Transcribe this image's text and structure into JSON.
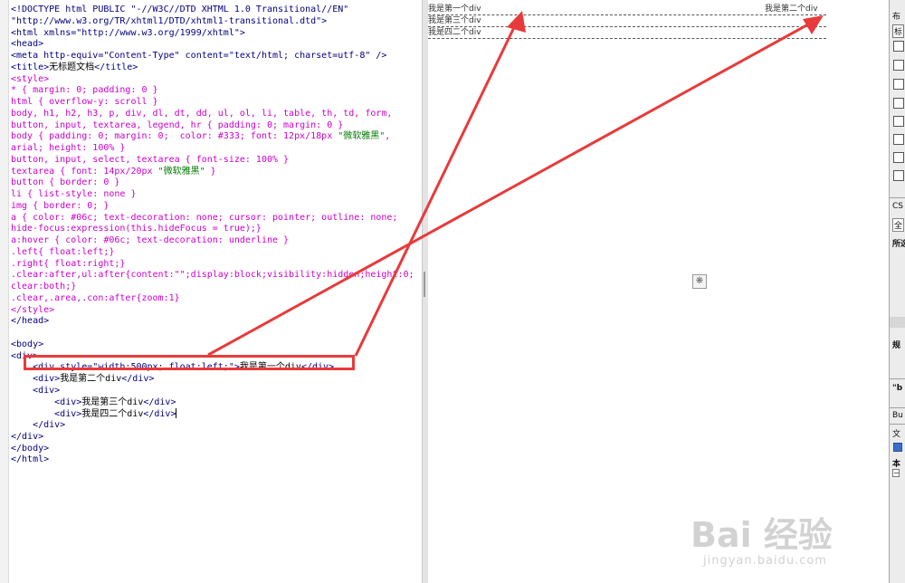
{
  "editor": {
    "lines": [
      [
        {
          "t": "<!DOCTYPE html PUBLIC \"-//W3C//DTD XHTML 1.0 Transitional//EN\"",
          "c": "c-tag"
        }
      ],
      [
        {
          "t": "\"http://www.w3.org/TR/xhtml1/DTD/xhtml1-transitional.dtd\">",
          "c": "c-tag"
        }
      ],
      [
        {
          "t": "<html xmlns=\"http://www.w3.org/1999/xhtml\">",
          "c": "c-tag"
        }
      ],
      [
        {
          "t": "<head>",
          "c": "c-tag"
        }
      ],
      [
        {
          "t": "<meta http-equiv=\"Content-Type\" content=\"text/html; charset=utf-8\" />",
          "c": "c-tag"
        }
      ],
      [
        {
          "t": "<title>",
          "c": "c-tag"
        },
        {
          "t": "无标题文档",
          "c": "c-txt"
        },
        {
          "t": "</title>",
          "c": "c-tag"
        }
      ],
      [
        {
          "t": "<style>",
          "c": "c-css"
        }
      ],
      [
        {
          "t": "* { margin: 0; padding: 0 }",
          "c": "c-css"
        }
      ],
      [
        {
          "t": "html { overflow-y: scroll }",
          "c": "c-css"
        }
      ],
      [
        {
          "t": "body, h1, h2, h3, p, div, dl, dt, dd, ul, ol, li, table, th, td, form,",
          "c": "c-css"
        }
      ],
      [
        {
          "t": "button, input, textarea, legend, hr { padding: 0; margin: 0 }",
          "c": "c-css"
        }
      ],
      [
        {
          "t": "body { padding: 0; margin: 0;  color: #333; font: 12px/18px ",
          "c": "c-css"
        },
        {
          "t": "\"微软雅黑\"",
          "c": "c-cn"
        },
        {
          "t": ",",
          "c": "c-css"
        }
      ],
      [
        {
          "t": "arial; height: 100% }",
          "c": "c-css"
        }
      ],
      [
        {
          "t": "button, input, select, textarea { font-size: 100% }",
          "c": "c-css"
        }
      ],
      [
        {
          "t": "textarea { font: 14px/20px ",
          "c": "c-css"
        },
        {
          "t": "\"微软雅黑\"",
          "c": "c-cn"
        },
        {
          "t": " }",
          "c": "c-css"
        }
      ],
      [
        {
          "t": "button { border: 0 }",
          "c": "c-css"
        }
      ],
      [
        {
          "t": "li { list-style: none }",
          "c": "c-css"
        }
      ],
      [
        {
          "t": "img { border: 0; }",
          "c": "c-css"
        }
      ],
      [
        {
          "t": "a { color: #06c; text-decoration: none; cursor: pointer; outline: none;",
          "c": "c-css"
        }
      ],
      [
        {
          "t": "hide-focus:expression(this.hideFocus = true);}",
          "c": "c-css"
        }
      ],
      [
        {
          "t": "a:hover { color: #06c; text-decoration: underline }",
          "c": "c-css"
        }
      ],
      [
        {
          "t": ".left{ float:left;}",
          "c": "c-css"
        }
      ],
      [
        {
          "t": ".right{ float:right;}",
          "c": "c-css"
        }
      ],
      [
        {
          "t": ".clear:after,ul:after{content:\"\";display:block;visibility:hidden;height:0;",
          "c": "c-css"
        }
      ],
      [
        {
          "t": "clear:both;}",
          "c": "c-css"
        }
      ],
      [
        {
          "t": ".clear,.area,.con:after{zoom:1}",
          "c": "c-css"
        }
      ],
      [
        {
          "t": "</style>",
          "c": "c-css"
        }
      ],
      [
        {
          "t": "</head>",
          "c": "c-tag"
        }
      ],
      [
        {
          "t": "",
          "c": "c-tag"
        }
      ],
      [
        {
          "t": "<body>",
          "c": "c-tag"
        }
      ],
      [
        {
          "t": "<div>",
          "c": "c-tag"
        }
      ],
      [
        {
          "t": "    <div style=\"width:500px; float:left;\">",
          "c": "c-tag"
        },
        {
          "t": "我是第一个div",
          "c": "c-txt"
        },
        {
          "t": "</div>",
          "c": "c-tag"
        }
      ],
      [
        {
          "t": "    <div>",
          "c": "c-tag"
        },
        {
          "t": "我是第二个div",
          "c": "c-txt"
        },
        {
          "t": "</div>",
          "c": "c-tag"
        }
      ],
      [
        {
          "t": "    <div>",
          "c": "c-tag"
        }
      ],
      [
        {
          "t": "        <div>",
          "c": "c-tag"
        },
        {
          "t": "我是第三个div",
          "c": "c-txt"
        },
        {
          "t": "</div>",
          "c": "c-tag"
        }
      ],
      [
        {
          "t": "        <div>",
          "c": "c-tag"
        },
        {
          "t": "我是四二个div",
          "c": "c-txt"
        },
        {
          "t": "</div>",
          "c": "c-tag"
        }
      ],
      [
        {
          "t": "    </div>",
          "c": "c-tag"
        }
      ],
      [
        {
          "t": "</div>",
          "c": "c-tag"
        }
      ],
      [
        {
          "t": "</body>",
          "c": "c-tag"
        }
      ],
      [
        {
          "t": "</html>",
          "c": "c-tag"
        }
      ]
    ],
    "caret_line": 35
  },
  "design": {
    "row1_left": "我是第一个div",
    "row1_right": "我是第二个div",
    "row2": "我是第三个div",
    "row3": "我是四二个div",
    "marker_glyph": "❋"
  },
  "panel": {
    "labels": [
      "布",
      "标",
      "CS",
      "全",
      "所选",
      "规",
      "\"b",
      "Bu",
      "文",
      "本"
    ],
    "icons": [
      "layout-icon",
      "table-icon",
      "image-icon",
      "media-icon",
      "form-icon",
      "template-icon",
      "tag-icon",
      "asset-icon"
    ]
  },
  "watermark": {
    "brand": "Bai 经验",
    "url": "jingyan.baidu.com"
  },
  "annotation": {
    "color": "#e83a3a"
  }
}
